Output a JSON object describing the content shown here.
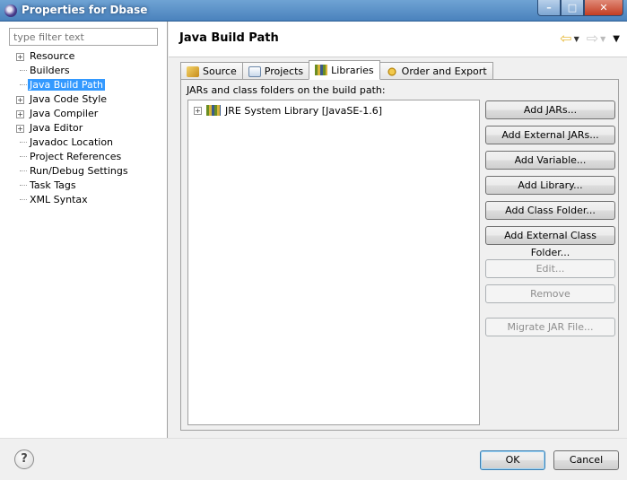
{
  "window": {
    "title": "Properties for Dbase",
    "min_glyph": "–",
    "max_glyph": "□",
    "close_glyph": "✕"
  },
  "filter": {
    "placeholder": "type filter text",
    "value": ""
  },
  "tree": {
    "items": [
      {
        "label": "Resource",
        "expandable": true,
        "selected": false
      },
      {
        "label": "Builders",
        "expandable": false,
        "selected": false
      },
      {
        "label": "Java Build Path",
        "expandable": false,
        "selected": true
      },
      {
        "label": "Java Code Style",
        "expandable": true,
        "selected": false
      },
      {
        "label": "Java Compiler",
        "expandable": true,
        "selected": false
      },
      {
        "label": "Java Editor",
        "expandable": true,
        "selected": false
      },
      {
        "label": "Javadoc Location",
        "expandable": false,
        "selected": false
      },
      {
        "label": "Project References",
        "expandable": false,
        "selected": false
      },
      {
        "label": "Run/Debug Settings",
        "expandable": false,
        "selected": false
      },
      {
        "label": "Task Tags",
        "expandable": false,
        "selected": false
      },
      {
        "label": "XML Syntax",
        "expandable": false,
        "selected": false
      }
    ]
  },
  "page": {
    "title": "Java Build Path",
    "tabs": [
      {
        "label": "Source",
        "icon": "source-folder-icon",
        "active": false
      },
      {
        "label": "Projects",
        "icon": "projects-icon",
        "active": false
      },
      {
        "label": "Libraries",
        "icon": "libraries-icon",
        "active": true
      },
      {
        "label": "Order and Export",
        "icon": "order-export-icon",
        "active": false
      }
    ],
    "panel_label": "JARs and class folders on the build path:",
    "libraries": [
      {
        "label": "JRE System Library [JavaSE-1.6]",
        "expandable": true
      }
    ],
    "buttons": {
      "add_jars": "Add JARs...",
      "add_external_jars": "Add External JARs...",
      "add_variable": "Add Variable...",
      "add_library": "Add Library...",
      "add_class_folder": "Add Class Folder...",
      "add_external_class_folder": "Add External Class Folder...",
      "edit": "Edit...",
      "remove": "Remove",
      "migrate_jar": "Migrate JAR File..."
    }
  },
  "footer": {
    "help": "?",
    "ok": "OK",
    "cancel": "Cancel"
  }
}
